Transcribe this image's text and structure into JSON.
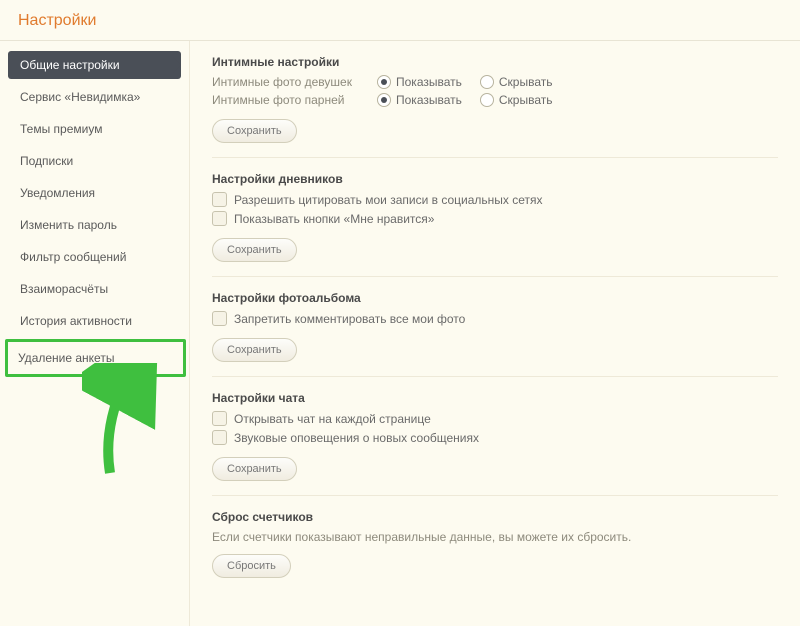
{
  "header": {
    "title": "Настройки"
  },
  "sidebar": {
    "items": [
      {
        "label": "Общие настройки",
        "active": true
      },
      {
        "label": "Сервис «Невидимка»"
      },
      {
        "label": "Темы премиум"
      },
      {
        "label": "Подписки"
      },
      {
        "label": "Уведомления"
      },
      {
        "label": "Изменить пароль"
      },
      {
        "label": "Фильтр сообщений"
      },
      {
        "label": "Взаиморасчёты"
      },
      {
        "label": "История активности"
      },
      {
        "label": "Удаление анкеты",
        "highlighted": true
      }
    ]
  },
  "sections": {
    "intimate": {
      "title": "Интимные настройки",
      "rows": [
        {
          "label": "Интимные фото девушек"
        },
        {
          "label": "Интимные фото парней"
        }
      ],
      "options": {
        "show": "Показывать",
        "hide": "Скрывать"
      },
      "save": "Сохранить"
    },
    "diaries": {
      "title": "Настройки дневников",
      "checks": [
        "Разрешить цитировать мои записи в социальных сетях",
        "Показывать кнопки «Мне нравится»"
      ],
      "save": "Сохранить"
    },
    "album": {
      "title": "Настройки фотоальбома",
      "checks": [
        "Запретить комментировать все мои фото"
      ],
      "save": "Сохранить"
    },
    "chat": {
      "title": "Настройки чата",
      "checks": [
        "Открывать чат на каждой странице",
        "Звуковые оповещения о новых сообщениях"
      ],
      "save": "Сохранить"
    },
    "counters": {
      "title": "Сброс счетчиков",
      "desc": "Если счетчики показывают неправильные данные, вы можете их сбросить.",
      "reset": "Сбросить"
    }
  }
}
